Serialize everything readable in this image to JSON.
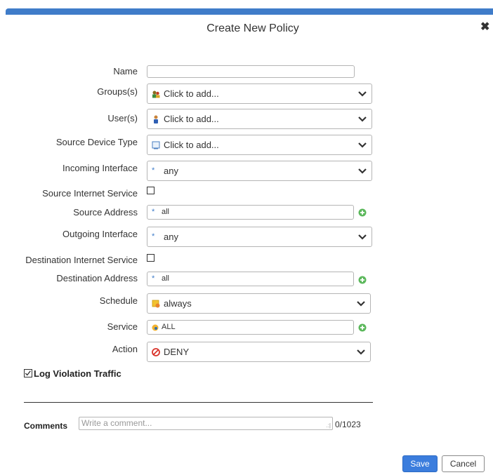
{
  "dialog": {
    "title": "Create New Policy",
    "close_icon": "close-icon"
  },
  "colors": {
    "accent": "#3f7cc9",
    "save_button": "#3b7ddd",
    "add_icon_green": "#5cb85c",
    "deny_red": "#d9342b"
  },
  "form": {
    "name": {
      "label": "Name",
      "value": ""
    },
    "groups": {
      "label": "Groups(s)",
      "value": "Click to add...",
      "icon": "group-icon"
    },
    "users": {
      "label": "User(s)",
      "value": "Click to add...",
      "icon": "user-icon"
    },
    "source_device_type": {
      "label": "Source Device Type",
      "value": "Click to add...",
      "icon": "device-icon"
    },
    "incoming_interface": {
      "label": "Incoming Interface",
      "value": "any",
      "icon": "asterisk-icon"
    },
    "source_internet_service": {
      "label": "Source Internet Service",
      "checked": false
    },
    "source_address": {
      "label": "Source Address",
      "value": "all",
      "icon": "asterisk-icon"
    },
    "outgoing_interface": {
      "label": "Outgoing Interface",
      "value": "any",
      "icon": "asterisk-icon"
    },
    "destination_internet_service": {
      "label": "Destination Internet Service",
      "checked": false
    },
    "destination_address": {
      "label": "Destination Address",
      "value": "all",
      "icon": "asterisk-icon"
    },
    "schedule": {
      "label": "Schedule",
      "value": "always",
      "icon": "schedule-icon"
    },
    "service": {
      "label": "Service",
      "value": "ALL",
      "icon": "service-icon"
    },
    "action": {
      "label": "Action",
      "value": "DENY",
      "icon": "deny-icon"
    }
  },
  "log_violation": {
    "label": "Log Violation Traffic",
    "checked": true
  },
  "comments": {
    "label": "Comments",
    "placeholder": "Write a comment...",
    "counter": "0/1023"
  },
  "footer": {
    "save_label": "Save",
    "cancel_label": "Cancel"
  }
}
